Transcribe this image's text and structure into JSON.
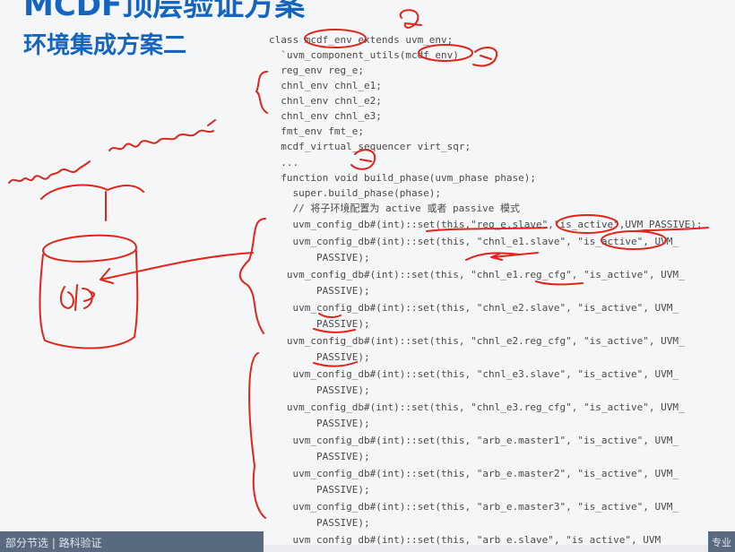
{
  "slide": {
    "title_line1": "MCDF顶层验证方案",
    "title_line2": "环境集成方案二"
  },
  "code_lines": [
    "class mcdf_env extends uvm_env;",
    "  `uvm_component_utils(mcdf_env)",
    "  reg_env reg_e;",
    "  chnl_env chnl_e1;",
    "  chnl_env chnl_e2;",
    "  chnl_env chnl_e3;",
    "  fmt_env fmt_e;",
    "  mcdf_virtual_sequencer virt_sqr;",
    "  ...",
    "  function void build_phase(uvm_phase phase);",
    "    super.build_phase(phase);",
    "    // 将子环境配置为 active 或者 passive 模式",
    "    uvm_config_db#(int)::set(this,\"reg_e.slave\",\"is_active\",UVM_PASSIVE);",
    "    uvm_config_db#(int)::set(this, \"chnl_e1.slave\", \"is_active\", UVM_",
    "        PASSIVE);",
    "   uvm_config_db#(int)::set(this, \"chnl_e1.reg_cfg\", \"is_active\", UVM_",
    "        PASSIVE);",
    "    uvm_config_db#(int)::set(this, \"chnl_e2.slave\", \"is_active\", UVM_",
    "        PASSIVE);",
    "   uvm_config_db#(int)::set(this, \"chnl_e2.reg_cfg\", \"is_active\", UVM_",
    "        PASSIVE);",
    "    uvm_config_db#(int)::set(this, \"chnl_e3.slave\", \"is_active\", UVM_",
    "        PASSIVE);",
    "   uvm_config_db#(int)::set(this, \"chnl_e3.reg_cfg\", \"is_active\", UVM_",
    "        PASSIVE);",
    "    uvm_config_db#(int)::set(this, \"arb_e.master1\", \"is_active\", UVM_",
    "        PASSIVE);",
    "    uvm_config_db#(int)::set(this, \"arb_e.master2\", \"is_active\", UVM_",
    "        PASSIVE);",
    "    uvm_config_db#(int)::set(this, \"arb_e.master3\", \"is_active\", UVM_",
    "        PASSIVE);",
    "    uvm_config_db#(int)::set(this, \"arb_e.slave\", \"is_active\", UVM_"
  ],
  "handwriting": {
    "annotation1": "path",
    "annotation2": "value",
    "db_label": "db"
  },
  "bottom_bar": {
    "left_text": "部分节选 | 路科验证",
    "right_text": "专业"
  },
  "colors": {
    "title": "#1565c0",
    "ink": "#e0251b",
    "code": "#4a4a4a"
  }
}
